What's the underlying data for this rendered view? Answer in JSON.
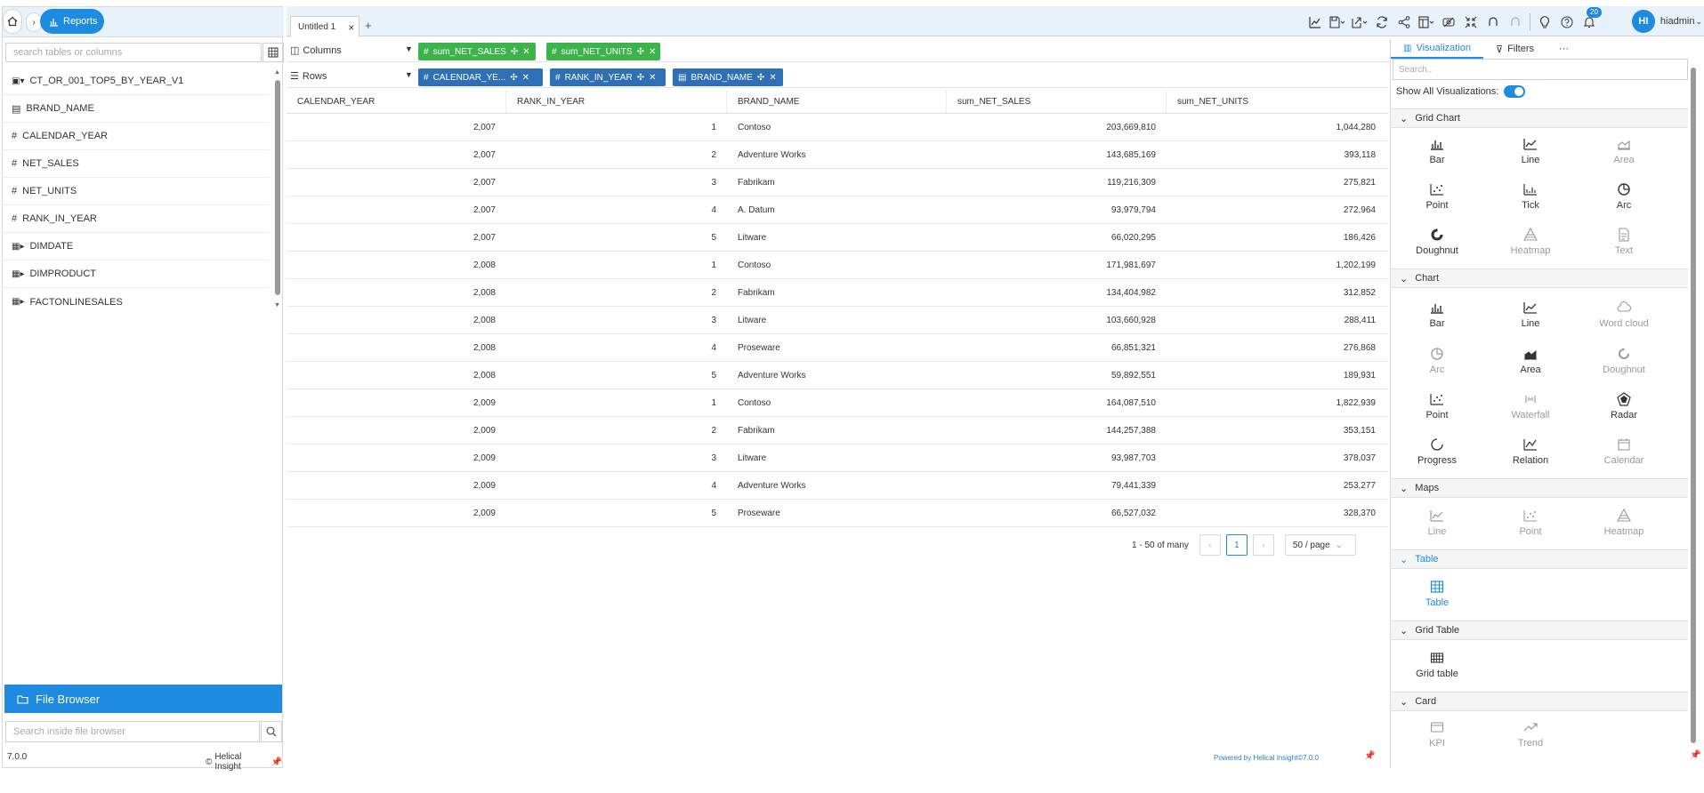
{
  "left": {
    "reports_label": "Reports",
    "search_placeholder": "search tables or columns",
    "tree": [
      {
        "label": "CT_OR_001_TOP5_BY_YEAR_V1",
        "icon": "database-icon",
        "kind": "root"
      },
      {
        "label": "BRAND_NAME",
        "icon": "text-field-icon",
        "kind": "field"
      },
      {
        "label": "CALENDAR_YEAR",
        "icon": "hash-icon",
        "kind": "field"
      },
      {
        "label": "NET_SALES",
        "icon": "hash-icon",
        "kind": "field"
      },
      {
        "label": "NET_UNITS",
        "icon": "hash-icon",
        "kind": "field"
      },
      {
        "label": "RANK_IN_YEAR",
        "icon": "hash-icon",
        "kind": "field"
      },
      {
        "label": "DIMDATE",
        "icon": "table-icon",
        "kind": "table"
      },
      {
        "label": "DIMPRODUCT",
        "icon": "table-icon",
        "kind": "table"
      },
      {
        "label": "FACTONLINESALES",
        "icon": "table-icon",
        "kind": "table"
      }
    ],
    "file_browser_label": "File Browser",
    "file_search_placeholder": "Search inside file browser",
    "version": "7.0.0",
    "brand": "Helical Insight"
  },
  "topbar": {
    "tab_label": "Untitled 1",
    "user": {
      "initials": "HI",
      "name": "hiadmin",
      "notifications": "20"
    }
  },
  "shelves": {
    "columns_label": "Columns",
    "rows_label": "Rows",
    "column_pills": [
      "sum_NET_SALES",
      "sum_NET_UNITS"
    ],
    "row_pills": [
      "CALENDAR_YE...",
      "RANK_IN_YEAR",
      "BRAND_NAME"
    ]
  },
  "table": {
    "headers": [
      "CALENDAR_YEAR",
      "RANK_IN_YEAR",
      "BRAND_NAME",
      "sum_NET_SALES",
      "sum_NET_UNITS"
    ],
    "rows": [
      [
        "2,007",
        "1",
        "Contoso",
        "203,669,810",
        "1,044,280"
      ],
      [
        "2,007",
        "2",
        "Adventure Works",
        "143,685,169",
        "393,118"
      ],
      [
        "2,007",
        "3",
        "Fabrikam",
        "119,216,309",
        "275,821"
      ],
      [
        "2,007",
        "4",
        "A. Datum",
        "93,979,794",
        "272,964"
      ],
      [
        "2,007",
        "5",
        "Litware",
        "66,020,295",
        "186,426"
      ],
      [
        "2,008",
        "1",
        "Contoso",
        "171,981,697",
        "1,202,199"
      ],
      [
        "2,008",
        "2",
        "Fabrikam",
        "134,404,982",
        "312,852"
      ],
      [
        "2,008",
        "3",
        "Litware",
        "103,660,928",
        "288,411"
      ],
      [
        "2,008",
        "4",
        "Proseware",
        "66,851,321",
        "276,868"
      ],
      [
        "2,008",
        "5",
        "Adventure Works",
        "59,892,551",
        "189,931"
      ],
      [
        "2,009",
        "1",
        "Contoso",
        "164,087,510",
        "1,822,939"
      ],
      [
        "2,009",
        "2",
        "Fabrikam",
        "144,257,388",
        "353,151"
      ],
      [
        "2,009",
        "3",
        "Litware",
        "93,987,703",
        "378,037"
      ],
      [
        "2,009",
        "4",
        "Adventure Works",
        "79,441,339",
        "253,277"
      ],
      [
        "2,009",
        "5",
        "Proseware",
        "66,527,032",
        "328,370"
      ]
    ]
  },
  "pager": {
    "summary": "1 - 50 of many",
    "current": "1",
    "page_size": "50 / page"
  },
  "powered_by": "Powered by Helical Insight©7.0.0",
  "right": {
    "tab_visualization": "Visualization",
    "tab_filters": "Filters",
    "more": "···",
    "search_placeholder": "Search..",
    "show_all_label": "Show All Visualizations:",
    "sections": {
      "grid_chart": "Grid Chart",
      "chart": "Chart",
      "maps": "Maps",
      "table": "Table",
      "grid_table": "Grid Table",
      "card": "Card"
    },
    "grid_chart_items": [
      "Bar",
      "Line",
      "Area",
      "Point",
      "Tick",
      "Arc",
      "Doughnut",
      "Heatmap",
      "Text"
    ],
    "chart_items": [
      "Bar",
      "Line",
      "Word cloud",
      "Arc",
      "Area",
      "Doughnut",
      "Point",
      "Waterfall",
      "Radar",
      "Progress",
      "Relation",
      "Calendar"
    ],
    "maps_items": [
      "Line",
      "Point",
      "Heatmap"
    ],
    "table_items": [
      "Table"
    ],
    "grid_table_items": [
      "Grid table"
    ],
    "card_items": [
      "KPI",
      "Trend"
    ]
  },
  "colors": {
    "accent": "#1f8be0",
    "green_pill": "#3cb44b",
    "blue_pill": "#2e6fb5"
  }
}
